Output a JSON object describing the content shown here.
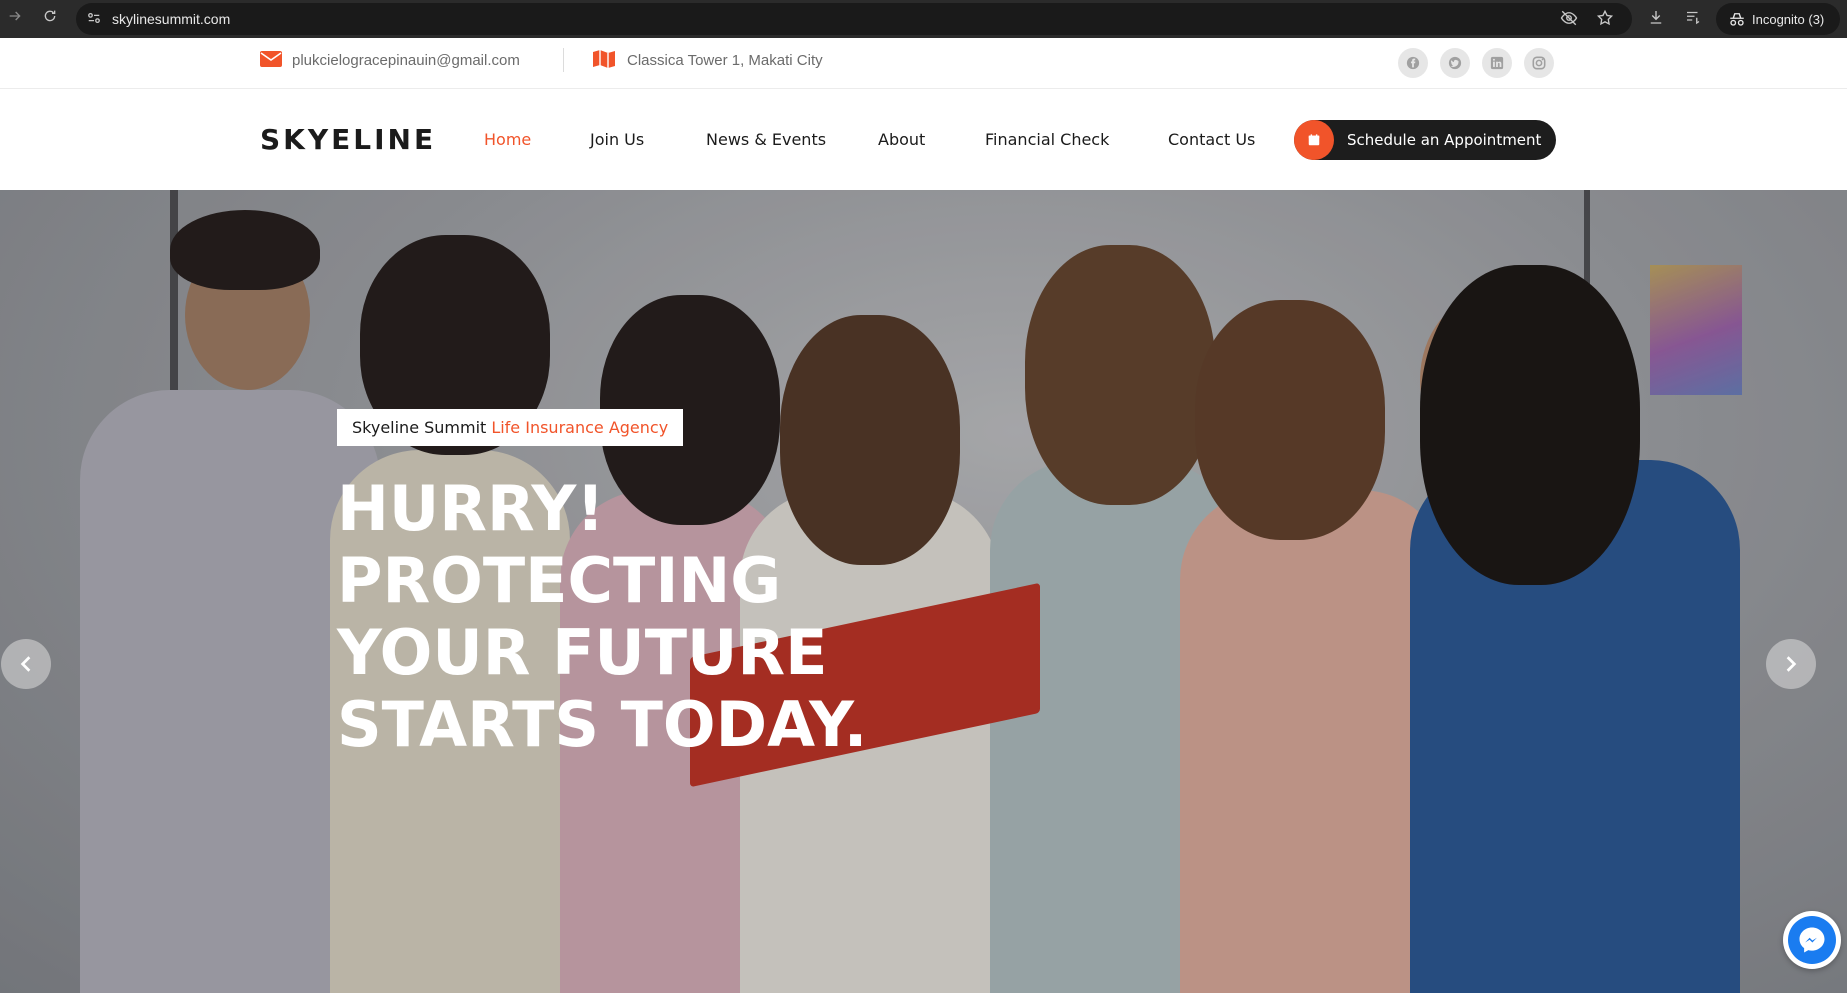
{
  "browser": {
    "url": "skylinesummit.com",
    "incognito_label": "Incognito (3)"
  },
  "topbar": {
    "email": "plukcielogracepinauin@gmail.com",
    "address": "Classica Tower 1, Makati City",
    "social": [
      "facebook-icon",
      "twitter-icon",
      "linkedin-icon",
      "instagram-icon"
    ]
  },
  "nav": {
    "logo": "SKYELINE",
    "links": [
      {
        "label": "Home",
        "active": true
      },
      {
        "label": "Join Us",
        "active": false
      },
      {
        "label": "News & Events",
        "active": false
      },
      {
        "label": "About",
        "active": false
      },
      {
        "label": "Financial Check",
        "active": false
      },
      {
        "label": "Contact Us",
        "active": false
      }
    ],
    "cta_label": "Schedule an Appointment"
  },
  "hero": {
    "tag_prefix": "Skyeline Summit",
    "tag_highlight": "Life Insurance Agency",
    "headline_lines": [
      "HURRY!",
      "PROTECTING",
      "YOUR FUTURE",
      "STARTS TODAY."
    ]
  },
  "colors": {
    "accent": "#f1542a",
    "dark": "#1d1d1d",
    "messenger": "#1a7cf0"
  }
}
